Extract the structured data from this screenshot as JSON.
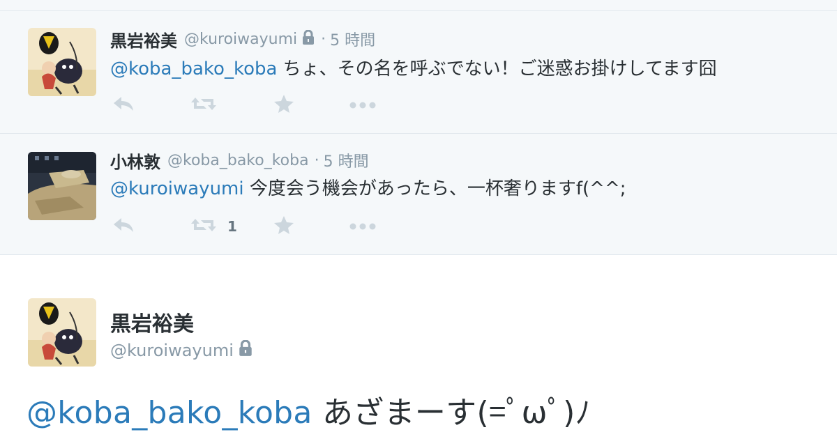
{
  "thread": [
    {
      "fullname": "黒岩裕美",
      "username": "@kuroiwayumi",
      "protected": true,
      "separator": "·",
      "time": "5 時間",
      "mention": "@koba_bako_koba",
      "text": " ちょ、その名を呼ぶでない！ご迷惑お掛けしてます囧",
      "retweet_count": ""
    },
    {
      "fullname": "小林敦",
      "username": "@koba_bako_koba",
      "protected": false,
      "separator": "·",
      "time": "5 時間",
      "mention": "@kuroiwayumi",
      "text": " 今度会う機会があったら、一杯奢りますf(^^;",
      "retweet_count": "1"
    }
  ],
  "main_tweet": {
    "fullname": "黒岩裕美",
    "username": "@kuroiwayumi",
    "protected": true,
    "mention": "@koba_bako_koba",
    "text": " あざまーす(=ﾟωﾟ)ﾉ"
  },
  "colors": {
    "link": "#2b7bb9",
    "muted": "#8899a6",
    "action_icon": "#ccd6dd",
    "thread_bg": "#f5f8fa"
  },
  "icons": [
    "reply-icon",
    "retweet-icon",
    "favorite-icon",
    "more-icon",
    "lock-icon"
  ]
}
